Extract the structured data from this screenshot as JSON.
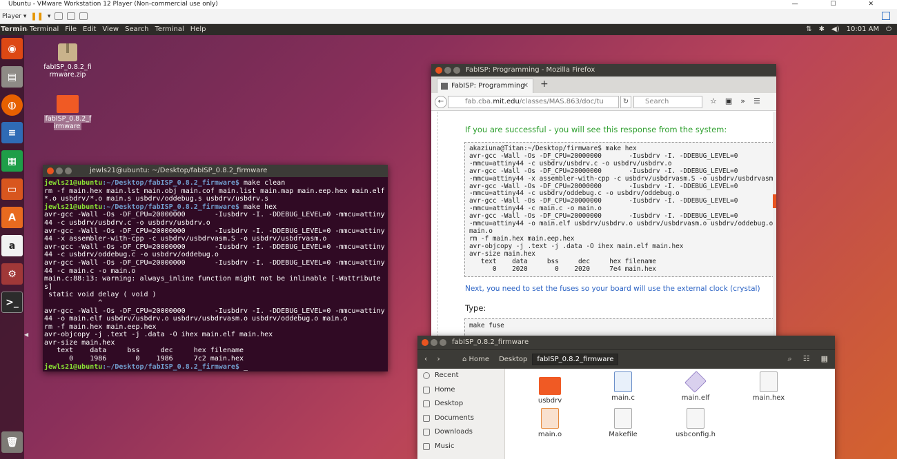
{
  "vmware": {
    "title": "Ubuntu - VMware Workstation 12 Player (Non-commercial use only)",
    "player_label": "Player ▾",
    "window_buttons": "— ☐ ✕"
  },
  "panel": {
    "app_name": "Terminal",
    "menus": [
      "Terminal",
      "File",
      "Edit",
      "View",
      "Search",
      "Terminal",
      "Help"
    ],
    "tray": [
      "⇅",
      "✱",
      "◀)",
      "10:01 AM",
      "⏻"
    ]
  },
  "desktop_icons": [
    {
      "label": "fabISP_0.8.2_firmware.zip",
      "type": "zip"
    },
    {
      "label": "fabISP_0.8.2_firmware",
      "type": "folder"
    }
  ],
  "terminal": {
    "title": "jewls21@ubuntu: ~/Desktop/fabISP_0.8.2_firmware",
    "prompt_user": "jewls21@ubuntu",
    "prompt_path": ":~/Desktop/fabISP_0.8.2_firmware$",
    "cmd1": " make clean",
    "out1": "rm -f main.hex main.lst main.obj main.cof main.list main.map main.eep.hex main.elf *.o usbdrv/*.o main.s usbdrv/oddebug.s usbdrv/usbdrv.s",
    "cmd2": " make hex",
    "out2": "avr-gcc -Wall -Os -DF_CPU=20000000\t -Iusbdrv -I. -DDEBUG_LEVEL=0 -mmcu=attiny44 -c usbdrv/usbdrv.c -o usbdrv/usbdrv.o\navr-gcc -Wall -Os -DF_CPU=20000000\t -Iusbdrv -I. -DDEBUG_LEVEL=0 -mmcu=attiny44 -x assembler-with-cpp -c usbdrv/usbdrvasm.S -o usbdrv/usbdrvasm.o\navr-gcc -Wall -Os -DF_CPU=20000000\t -Iusbdrv -I. -DDEBUG_LEVEL=0 -mmcu=attiny44 -c usbdrv/oddebug.c -o usbdrv/oddebug.o\navr-gcc -Wall -Os -DF_CPU=20000000\t -Iusbdrv -I. -DDEBUG_LEVEL=0 -mmcu=attiny44 -c main.c -o main.o\nmain.c:88:13: warning: always_inline function might not be inlinable [-Wattributes]\n static void delay ( void )\n             ^\navr-gcc -Wall -Os -DF_CPU=20000000\t -Iusbdrv -I. -DDEBUG_LEVEL=0 -mmcu=attiny44 -o main.elf usbdrv/usbdrv.o usbdrv/usbdrvasm.o usbdrv/oddebug.o main.o\nrm -f main.hex main.eep.hex\navr-objcopy -j .text -j .data -O ihex main.elf main.hex\navr-size main.hex\n   text\t   data\t    bss\t    dec\t    hex\tfilename\n      0\t   1986\t      0\t   1986\t    7c2\tmain.hex"
  },
  "firefox": {
    "title": "FabISP: Programming - Mozilla Firefox",
    "tab_label": "FabISP: Programming",
    "url_prefix": "fab.cba.",
    "url_domain": "mit.edu",
    "url_rest": "/classes/MAS.863/doc/tu",
    "search_placeholder": "Search",
    "success_text": "If you are successful - you will see this response from the system:",
    "code": "akaziuna@Titan:~/Desktop/firmware$ make hex\navr-gcc -Wall -Os -DF_CPU=20000000       -Iusbdrv -I. -DDEBUG_LEVEL=0\n-mmcu=attiny44 -c usbdrv/usbdrv.c -o usbdrv/usbdrv.o\navr-gcc -Wall -Os -DF_CPU=20000000       -Iusbdrv -I. -DDEBUG_LEVEL=0\n-mmcu=attiny44 -x assembler-with-cpp -c usbdrv/usbdrvasm.S -o usbdrv/usbdrvasm.o\navr-gcc -Wall -Os -DF_CPU=20000000       -Iusbdrv -I. -DDEBUG_LEVEL=0\n-mmcu=attiny44 -c usbdrv/oddebug.c -o usbdrv/oddebug.o\navr-gcc -Wall -Os -DF_CPU=20000000       -Iusbdrv -I. -DDEBUG_LEVEL=0\n-mmcu=attiny44 -c main.c -o main.o\navr-gcc -Wall -Os -DF_CPU=20000000       -Iusbdrv -I. -DDEBUG_LEVEL=0\n-mmcu=attiny44 -o main.elf usbdrv/usbdrv.o usbdrv/usbdrvasm.o usbdrv/oddebug.o\nmain.o\nrm -f main.hex main.eep.hex\navr-objcopy -j .text -j .data -O ihex main.elf main.hex\navr-size main.hex\n   text    data     bss     dec     hex filename\n      0    2020       0    2020     7e4 main.hex",
    "next_text": "Next, you need to set the fuses so your board will use the external clock (crystal)",
    "type_label": "Type:",
    "code2": "make fuse"
  },
  "files": {
    "title": "fabISP_0.8.2_firmware",
    "crumbs": [
      "⌂ Home",
      "Desktop",
      "fabISP_0.8.2_firmware"
    ],
    "sidebar": [
      "Recent",
      "Home",
      "Desktop",
      "Documents",
      "Downloads",
      "Music"
    ],
    "items": [
      {
        "name": "usbdrv",
        "type": "folder"
      },
      {
        "name": "main.c",
        "type": "c"
      },
      {
        "name": "main.elf",
        "type": "elf"
      },
      {
        "name": "main.hex",
        "type": "text"
      },
      {
        "name": "main.o",
        "type": "obj"
      },
      {
        "name": "Makefile",
        "type": "text"
      },
      {
        "name": "usbconfig.h",
        "type": "text"
      }
    ]
  }
}
